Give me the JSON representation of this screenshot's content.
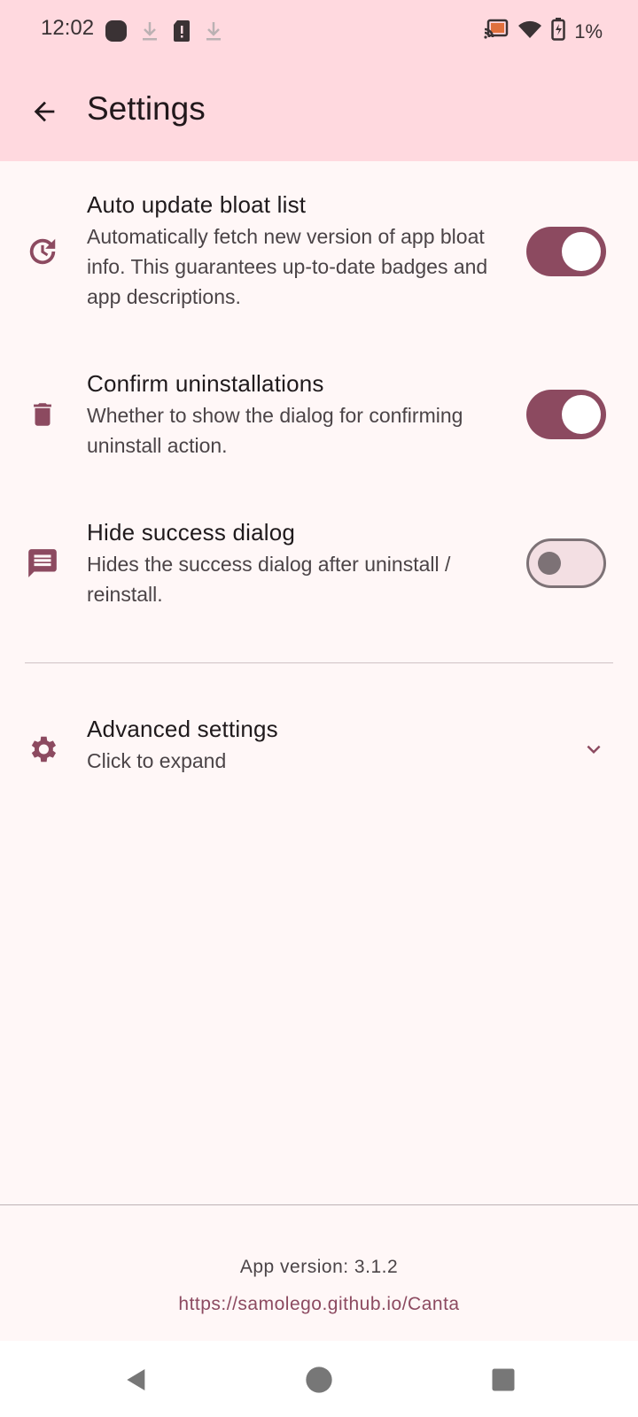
{
  "status_bar": {
    "time": "12:02",
    "battery": "1%",
    "icons_left": [
      "app-notification-icon",
      "download-icon",
      "sim-alert-icon",
      "download-icon"
    ],
    "icons_right": [
      "cast-icon",
      "wifi-icon",
      "battery-charging-icon"
    ]
  },
  "app_bar": {
    "title": "Settings",
    "back_icon": "arrow-back-icon"
  },
  "settings": [
    {
      "title": "Auto update bloat list",
      "description": "Automatically fetch new version of app bloat info. This guarantees up-to-date badges and app descriptions.",
      "icon": "update-clock-icon",
      "enabled": true
    },
    {
      "title": "Confirm uninstallations",
      "description": "Whether to show the dialog for confirming uninstall action.",
      "icon": "trash-icon",
      "enabled": true
    },
    {
      "title": "Hide success dialog",
      "description": "Hides the success dialog after uninstall / reinstall.",
      "icon": "message-icon",
      "enabled": false
    }
  ],
  "advanced": {
    "title": "Advanced settings",
    "subtitle": "Click to expand",
    "icon": "gear-icon"
  },
  "footer": {
    "version": "App version: 3.1.2",
    "link": "https://samolego.github.io/Canta"
  },
  "colors": {
    "accent": "#8c4a60",
    "header_bg": "#ffd9df",
    "page_bg": "#fff7f7"
  }
}
